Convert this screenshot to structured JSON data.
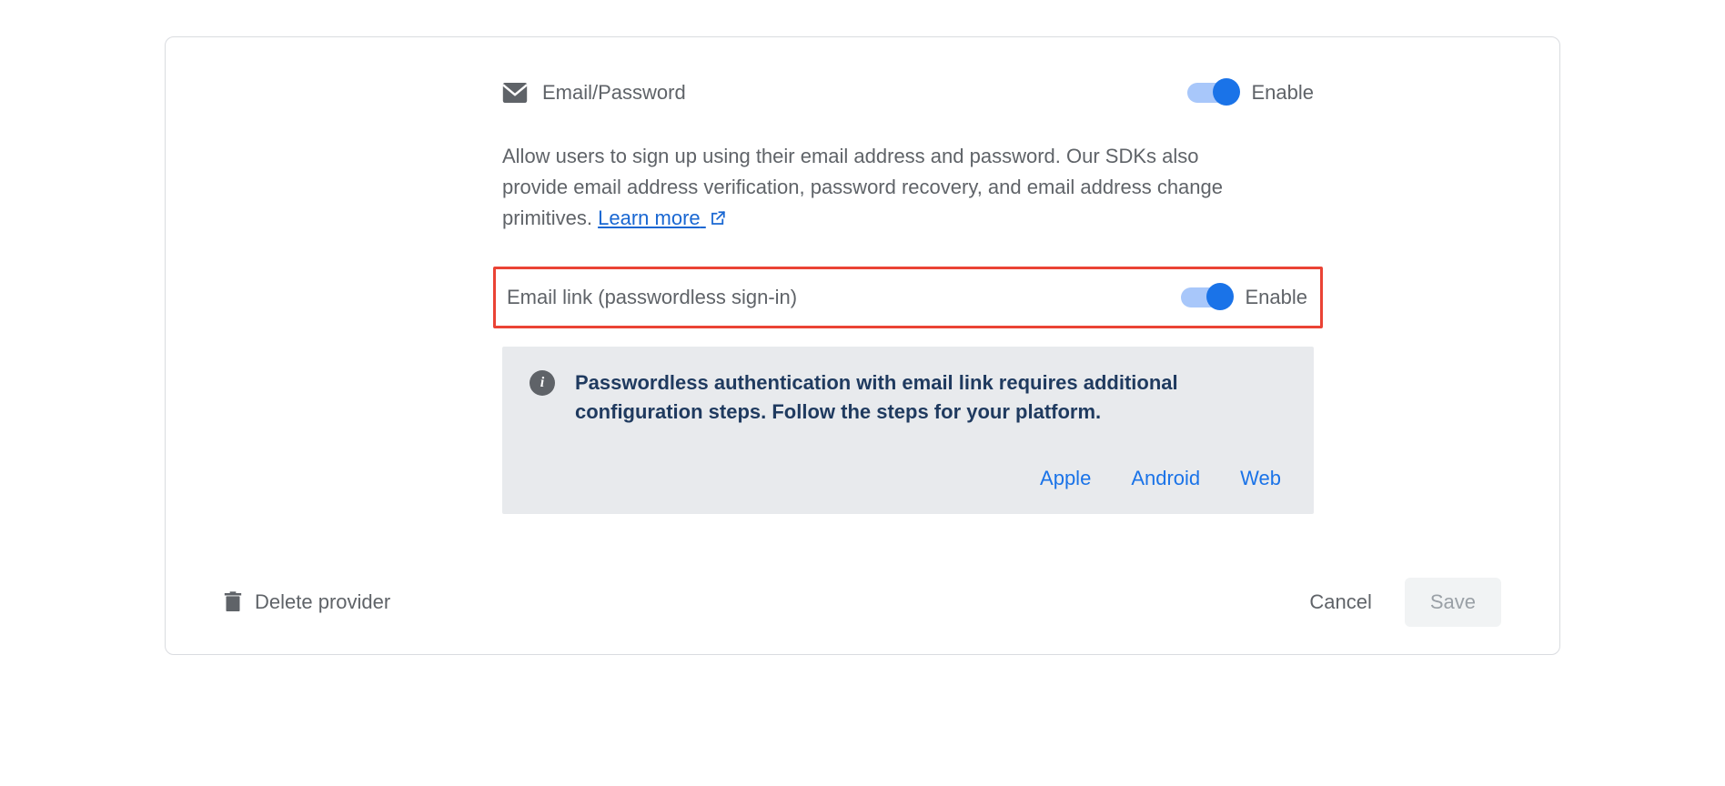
{
  "provider": {
    "title": "Email/Password",
    "enable_label": "Enable"
  },
  "description": {
    "text": "Allow users to sign up using their email address and password. Our SDKs also provide email address verification, password recovery, and email address change primitives. ",
    "learn_more": "Learn more"
  },
  "email_link": {
    "title": "Email link (passwordless sign-in)",
    "enable_label": "Enable"
  },
  "info": {
    "text": "Passwordless authentication with email link requires additional configuration steps. Follow the steps for your platform.",
    "platforms": {
      "apple": "Apple",
      "android": "Android",
      "web": "Web"
    }
  },
  "footer": {
    "delete": "Delete provider",
    "cancel": "Cancel",
    "save": "Save"
  }
}
